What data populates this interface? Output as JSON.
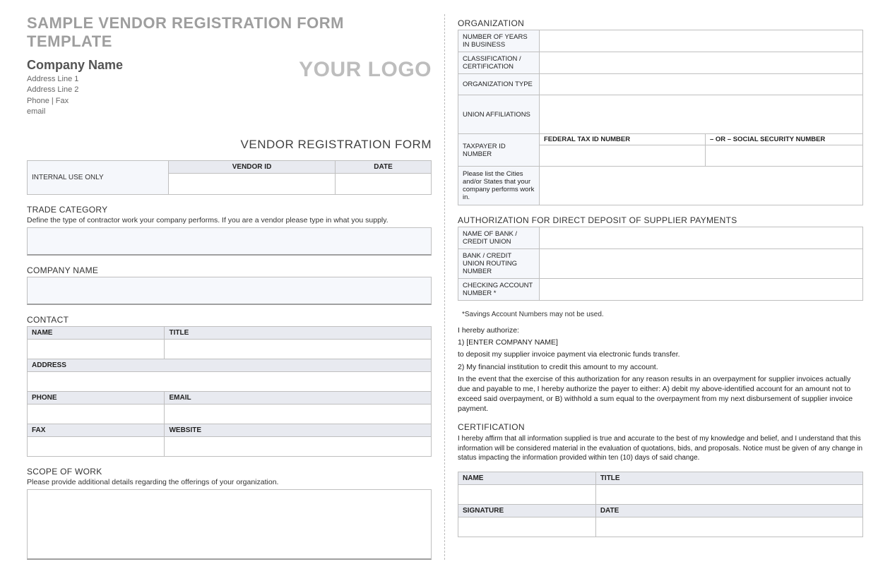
{
  "page_title": "SAMPLE VENDOR REGISTRATION FORM TEMPLATE",
  "header": {
    "company_name": "Company Name",
    "addr1": "Address Line 1",
    "addr2": "Address Line 2",
    "phone_fax": "Phone | Fax",
    "email": "email",
    "logo_text": "YOUR LOGO"
  },
  "form_title": "VENDOR REGISTRATION FORM",
  "internal": {
    "label": "INTERNAL USE ONLY",
    "col1": "VENDOR ID",
    "col2": "DATE"
  },
  "trade": {
    "title": "TRADE CATEGORY",
    "sub": "Define the type of contractor work your company performs. If you are a vendor please type in what you supply."
  },
  "company_name_label": "COMPANY NAME",
  "contact": {
    "title": "CONTACT",
    "name": "NAME",
    "titlef": "TITLE",
    "address": "ADDRESS",
    "phone": "PHONE",
    "email": "EMAIL",
    "fax": "FAX",
    "website": "WEBSITE"
  },
  "scope": {
    "title": "SCOPE OF WORK",
    "sub": "Please provide additional details regarding the offerings of your organization."
  },
  "org": {
    "title": "ORGANIZATION",
    "years": "NUMBER OF YEARS IN BUSINESS",
    "class": "CLASSIFICATION / CERTIFICATION",
    "orgtype": "ORGANIZATION TYPE",
    "union": "UNION AFFILIATIONS",
    "taxid": "TAXPAYER ID NUMBER",
    "fed": "FEDERAL TAX ID NUMBER",
    "or_ssn": "– OR –   SOCIAL SECURITY NUMBER",
    "cities": "Please list the Cities and/or States that your company performs work in."
  },
  "auth": {
    "title": "AUTHORIZATION FOR DIRECT DEPOSIT OF SUPPLIER PAYMENTS",
    "bank": "NAME OF BANK / CREDIT UNION",
    "routing": "BANK / CREDIT UNION ROUTING NUMBER",
    "checking": "CHECKING ACCOUNT NUMBER *",
    "note": "*Savings Account Numbers may not be used.",
    "line_auth": "I hereby authorize:",
    "line1": "1) [ENTER COMPANY NAME]",
    "line_deposit": "to deposit my supplier invoice payment via electronic funds transfer.",
    "line2": "2) My financial institution to credit this amount to my account.",
    "para": "In the event that the exercise of this authorization for any reason results in an overpayment for supplier invoices actually due and payable to me, I hereby authorize the payer to either: A) debit my above-identified account for an amount not to exceed said overpayment, or B) withhold a sum equal to the overpayment from my next disbursement of supplier invoice payment."
  },
  "cert": {
    "title": "CERTIFICATION",
    "para": "I hereby affirm that all information supplied is true and accurate to the best of my knowledge and belief, and I understand that this information will be considered material in the evaluation of quotations, bids, and proposals. Notice must be given of any change in status impacting the information provided within ten (10) days of said change.",
    "name": "NAME",
    "titlef": "TITLE",
    "sig": "SIGNATURE",
    "date": "DATE"
  }
}
